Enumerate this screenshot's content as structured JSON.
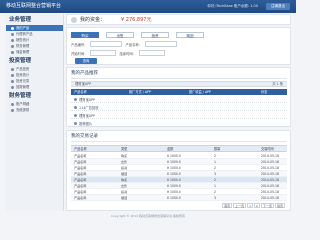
{
  "header": {
    "brand": "移动互联网整合营销平台",
    "user": "你好,iTechBase 账户余额: 1.00",
    "logout_label": "注销退出"
  },
  "sidebar": {
    "groups": [
      {
        "title": "业务管理",
        "items": [
          {
            "label": "我的产品"
          },
          {
            "label": "代理商产品"
          },
          {
            "label": "销售统计"
          },
          {
            "label": "财务管理"
          },
          {
            "label": "佣金管理"
          }
        ]
      },
      {
        "title": "投资管理",
        "items": [
          {
            "label": "产品投资"
          },
          {
            "label": "投资统计"
          },
          {
            "label": "投资记录"
          },
          {
            "label": "回报管理"
          }
        ]
      },
      {
        "title": "财务管理",
        "items": [
          {
            "label": "账户明细"
          },
          {
            "label": "充值提现"
          }
        ]
      }
    ]
  },
  "assets": {
    "label": "我的资金：",
    "amount": "¥ 276,897元"
  },
  "search": {
    "tabs": [
      {
        "label": "购买"
      },
      {
        "label": "出售"
      },
      {
        "label": "投资"
      },
      {
        "label": "赎回"
      }
    ],
    "row1": {
      "label1": "产品编号：",
      "label2": "产品名称："
    },
    "row2": {
      "label1": "开始时间：",
      "label2": "结束时间："
    },
    "submit_label": "查询"
  },
  "products": {
    "title": "我的产品推荐",
    "subbar": "理财宝APP",
    "count": "共 1 条",
    "head": [
      "产品名称",
      "推广方式 / APP",
      "推广收益 / APP",
      "状态"
    ],
    "rows": [
      {
        "label": "理财宝APP"
      },
      {
        "label": "114广告投放"
      },
      {
        "label": "理财宝APP"
      },
      {
        "label": "推荐图片"
      }
    ]
  },
  "records": {
    "title": "我的交易记录",
    "subtitle": "交易明细",
    "columns": [
      "产品名称",
      "类型",
      "金额",
      "数量",
      "交易时间"
    ],
    "rows": [
      [
        "产品名称",
        "购买",
        "¥ 1000.0",
        "2",
        "2014-05-18"
      ],
      [
        "产品名称",
        "出售",
        "¥ 1000.0",
        "1",
        "2014-05-18"
      ],
      [
        "产品名称",
        "投资",
        "¥ 1000.0",
        "2",
        "2014-05-18"
      ],
      [
        "产品名称",
        "赎回",
        "¥ 1000.0",
        "3",
        "2014-05-18"
      ],
      [
        "产品名称",
        "购买",
        "¥ 1000.0",
        "2",
        "2014-05-18"
      ],
      [
        "产品名称",
        "出售",
        "¥ 1000.0",
        "1",
        "2014-05-18"
      ],
      [
        "产品名称",
        "投资",
        "¥ 1000.0",
        "2",
        "2014-05-18"
      ],
      [
        "产品名称",
        "赎回",
        "¥ 1000.0",
        "3",
        "2014-05-18"
      ]
    ],
    "pager": [
      "首页",
      "上一页",
      "1",
      "2",
      "下一页",
      "尾页"
    ]
  },
  "footer": "Copyright © 2014 移动互联网整合营销平台 版权所有"
}
